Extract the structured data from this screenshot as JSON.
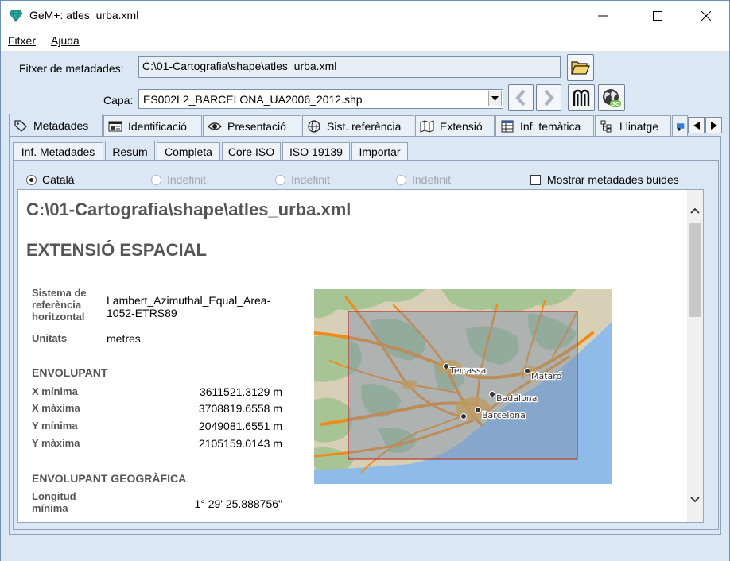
{
  "window": {
    "title": "GeM+: atles_urba.xml",
    "minimize": "—",
    "maximize": "☐",
    "close": "✕"
  },
  "menu": [
    {
      "label": "Fitxer"
    },
    {
      "label": "Ajuda"
    }
  ],
  "file_field": {
    "label": "Fitxer de metadades:",
    "value": "C:\\01-Cartografia\\shape\\atles_urba.xml"
  },
  "layer": {
    "label": "Capa:",
    "value": "ES002L2_BARCELONA_UA2006_2012.shp"
  },
  "main_tabs": [
    {
      "label": "Metadades",
      "icon": "tag-icon"
    },
    {
      "label": "Identificació",
      "icon": "id-card-icon"
    },
    {
      "label": "Presentació",
      "icon": "eye-icon"
    },
    {
      "label": "Sist. referència",
      "icon": "globe-icon"
    },
    {
      "label": "Extensió",
      "icon": "map-icon"
    },
    {
      "label": "Inf. temàtica",
      "icon": "table-icon"
    },
    {
      "label": "Llinatge",
      "icon": "tree-icon"
    }
  ],
  "sub_tabs": [
    {
      "label": "Inf. Metadades"
    },
    {
      "label": "Resum"
    },
    {
      "label": "Completa"
    },
    {
      "label": "Core ISO"
    },
    {
      "label": "ISO 19139"
    },
    {
      "label": "Importar"
    }
  ],
  "languages": [
    {
      "label": "Català",
      "selected": true,
      "enabled": true
    },
    {
      "label": "Indefinit",
      "selected": false,
      "enabled": false
    },
    {
      "label": "Indefinit",
      "selected": false,
      "enabled": false
    },
    {
      "label": "Indefinit",
      "selected": false,
      "enabled": false
    }
  ],
  "show_empty": {
    "label": "Mostrar metadades buides",
    "checked": false
  },
  "doc": {
    "title": "C:\\01-Cartografia\\shape\\atles_urba.xml",
    "section": "EXTENSIÓ ESPACIAL",
    "crs_label": "Sistema de referència horitzontal",
    "crs_value": "Lambert_Azimuthal_Equal_Area-1052-ETRS89",
    "units_label": "Unitats",
    "units_value": "metres",
    "envelope_title": "ENVOLUPANT",
    "envelope": [
      {
        "label": "X mínima",
        "value": "3611521.3129 m"
      },
      {
        "label": "X màxima",
        "value": "3708819.6558 m"
      },
      {
        "label": "Y mínima",
        "value": "2049081.6551 m"
      },
      {
        "label": "Y màxima",
        "value": "2105159.0143 m"
      }
    ],
    "geo_envelope_title": "ENVOLUPANT GEOGRÀFICA",
    "geo_envelope": [
      {
        "label": "Longitud mínima",
        "value": "1° 29' 25.888756\""
      }
    ]
  },
  "map": {
    "cities": [
      {
        "name": "Terrassa"
      },
      {
        "name": "Mataró"
      },
      {
        "name": "Badalona"
      },
      {
        "name": "Barcelona"
      }
    ],
    "colors": {
      "land": "#d9d1bd",
      "forest": "#a9c79a",
      "sea": "#8fbbe8",
      "road": "#f08a1a",
      "extent": "#c0392b"
    }
  }
}
